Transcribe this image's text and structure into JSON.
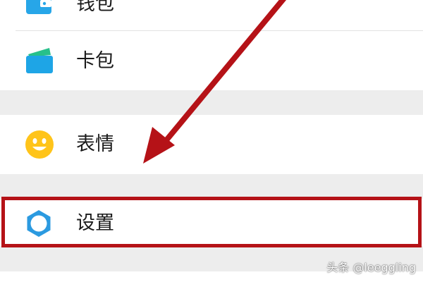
{
  "menu": {
    "items": [
      {
        "label": "钱包",
        "icon": "wallet-icon"
      },
      {
        "label": "卡包",
        "icon": "card-package-icon"
      },
      {
        "label": "表情",
        "icon": "smiley-icon"
      },
      {
        "label": "设置",
        "icon": "settings-gear-icon"
      }
    ]
  },
  "annotation": {
    "highlight_color": "#b51217",
    "highlighted_item": "设置"
  },
  "watermark": {
    "text": "头条 @leeggling"
  },
  "colors": {
    "wallet_blue": "#27a6e8",
    "card_green": "#27c08b",
    "smiley_yellow": "#ffc41a",
    "gear_blue": "#2b9ae0",
    "background": "#ededed"
  }
}
